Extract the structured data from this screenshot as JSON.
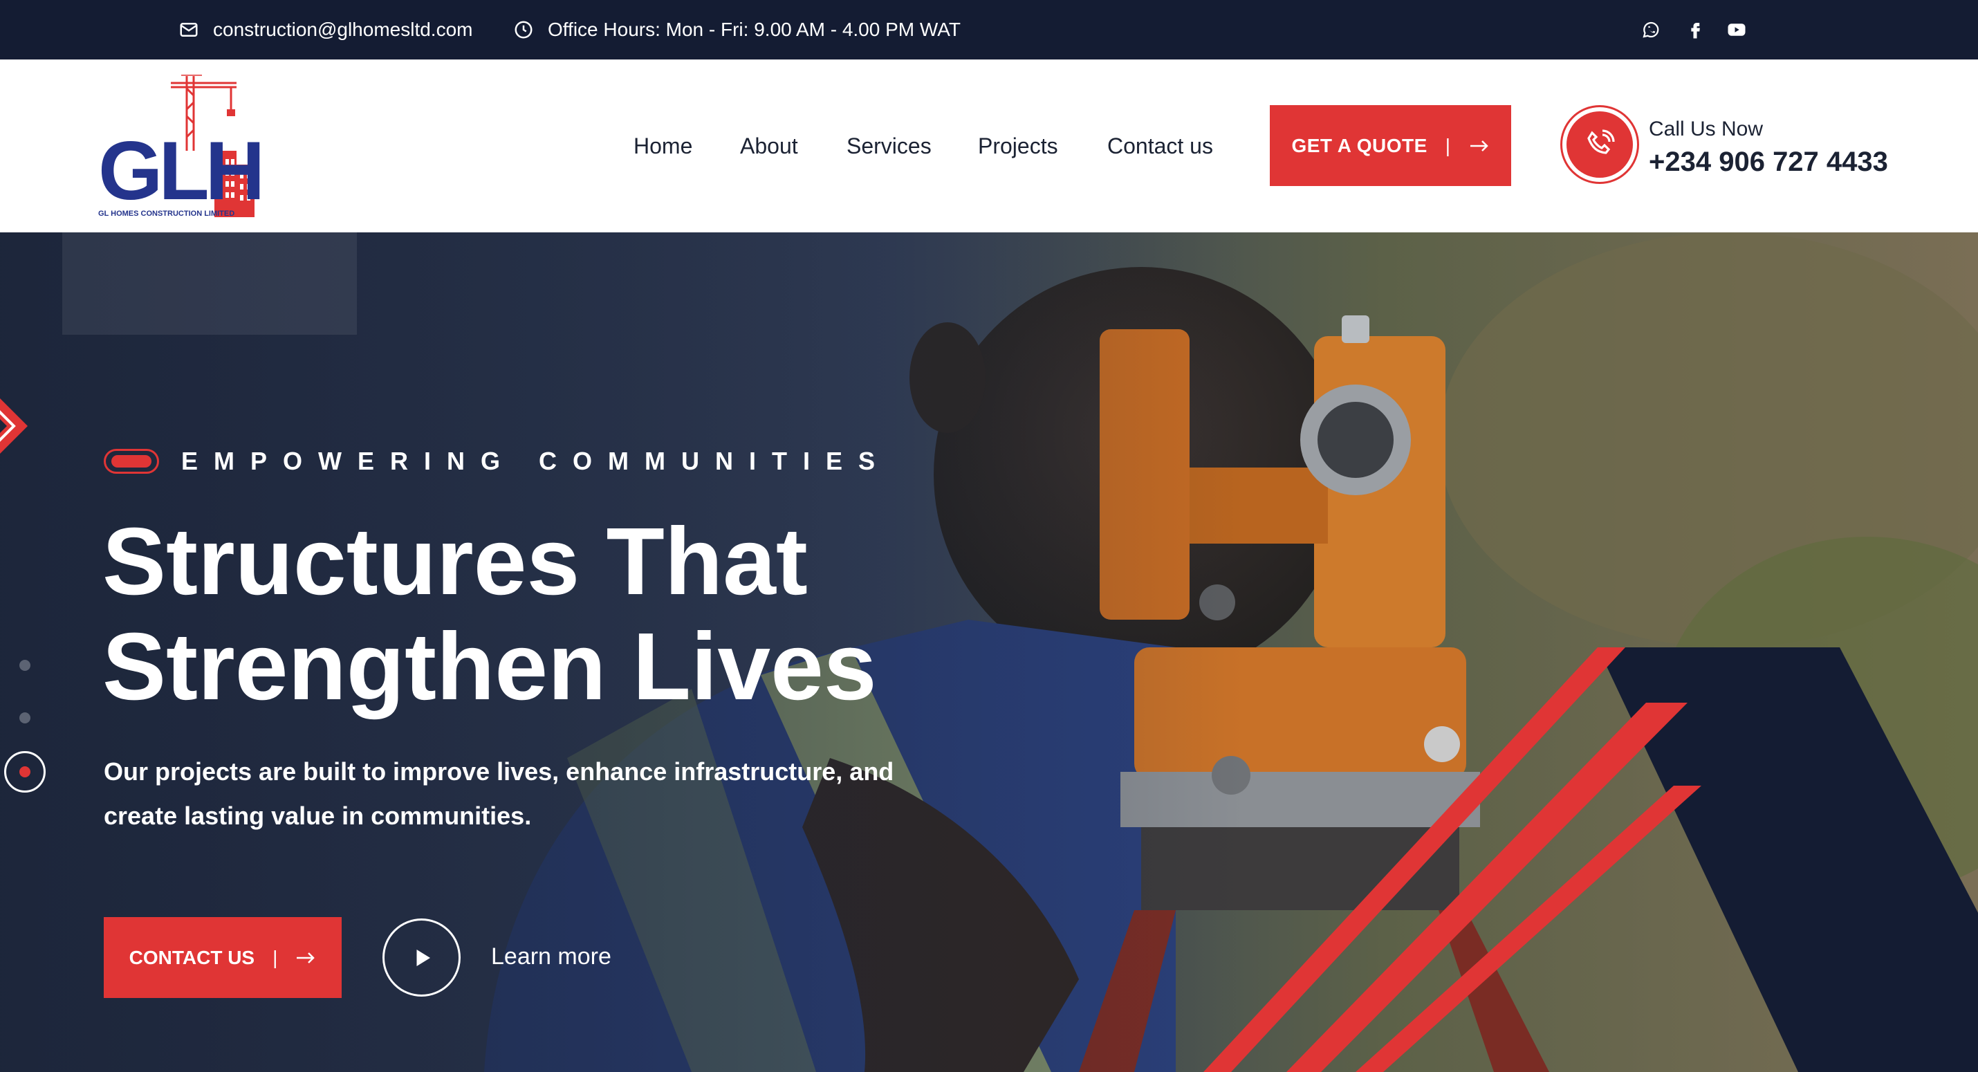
{
  "topbar": {
    "email": "construction@glhomesltd.com",
    "hours": "Office Hours: Mon - Fri: 9.00 AM - 4.00 PM WAT",
    "social": [
      "whatsapp-icon",
      "facebook-icon",
      "youtube-icon"
    ]
  },
  "logo": {
    "letters": "GLH",
    "caption": "GL HOMES CONSTRUCTION LIMITED"
  },
  "nav": {
    "items": [
      "Home",
      "About",
      "Services",
      "Projects",
      "Contact us"
    ]
  },
  "header": {
    "quote_label": "GET A QUOTE",
    "quote_sep": "|",
    "call_label": "Call Us Now",
    "call_number": "+234 906 727 4433"
  },
  "hero": {
    "eyebrow": "EMPOWERING COMMUNITIES",
    "title_line1": "Structures That",
    "title_line2": "Strengthen Lives",
    "text": "Our projects are built to improve lives, enhance infrastructure, and create lasting value in communities.",
    "contact_label": "CONTACT US",
    "contact_sep": "|",
    "learn_more": "Learn more",
    "slider_active": 3,
    "slider_count": 3
  },
  "colors": {
    "accent": "#e03535",
    "navy": "#141c33",
    "text_dark": "#1b2233"
  }
}
